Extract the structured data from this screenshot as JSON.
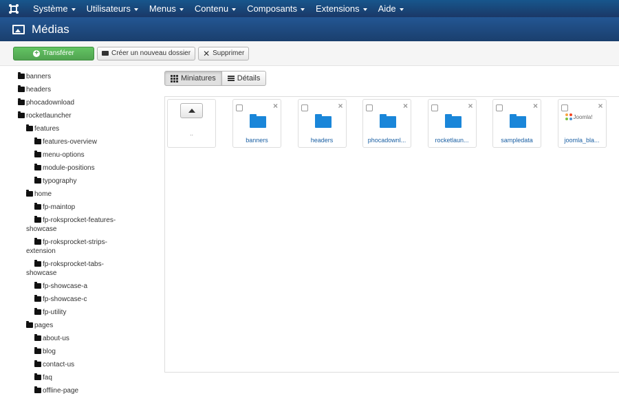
{
  "navbar": {
    "logo_icon": "joomla-logo-icon",
    "menu": [
      {
        "label": "Système"
      },
      {
        "label": "Utilisateurs"
      },
      {
        "label": "Menus"
      },
      {
        "label": "Contenu"
      },
      {
        "label": "Composants"
      },
      {
        "label": "Extensions"
      },
      {
        "label": "Aide"
      }
    ]
  },
  "page": {
    "title": "Médias",
    "title_icon": "image-icon"
  },
  "toolbar": {
    "upload_label": "Transférer",
    "new_folder_label": "Créer un nouveau dossier",
    "delete_label": "Supprimer"
  },
  "tree": [
    {
      "label": "banners",
      "level": 0
    },
    {
      "label": "headers",
      "level": 0
    },
    {
      "label": "phocadownload",
      "level": 0
    },
    {
      "label": "rocketlauncher",
      "level": 0
    },
    {
      "label": "features",
      "level": 1
    },
    {
      "label": "features-overview",
      "level": 2
    },
    {
      "label": "menu-options",
      "level": 2
    },
    {
      "label": "module-positions",
      "level": 2
    },
    {
      "label": "typography",
      "level": 2
    },
    {
      "label": "home",
      "level": 1
    },
    {
      "label": "fp-maintop",
      "level": 2
    },
    {
      "label": "fp-roksprocket-features-",
      "label2": "showcase",
      "level": 2
    },
    {
      "label": "fp-roksprocket-strips-",
      "label2": "extension",
      "level": 2
    },
    {
      "label": "fp-roksprocket-tabs-",
      "label2": "showcase",
      "level": 2
    },
    {
      "label": "fp-showcase-a",
      "level": 2
    },
    {
      "label": "fp-showcase-c",
      "level": 2
    },
    {
      "label": "fp-utility",
      "level": 2
    },
    {
      "label": "pages",
      "level": 1
    },
    {
      "label": "about-us",
      "level": 2
    },
    {
      "label": "blog",
      "level": 2
    },
    {
      "label": "contact-us",
      "level": 2
    },
    {
      "label": "faq",
      "level": 2
    },
    {
      "label": "offline-page",
      "level": 2
    }
  ],
  "view": {
    "thumbnails_label": "Miniatures",
    "details_label": "Détails"
  },
  "media": {
    "up_label": "..",
    "items": [
      {
        "label": "banners",
        "type": "folder"
      },
      {
        "label": "headers",
        "type": "folder"
      },
      {
        "label": "phocadownl...",
        "type": "folder"
      },
      {
        "label": "rocketlaun...",
        "type": "folder"
      },
      {
        "label": "sampledata",
        "type": "folder"
      },
      {
        "label": "joomla_bla...",
        "type": "image",
        "logo_text": "Joomla!"
      }
    ],
    "close_glyph": "×"
  },
  "colors": {
    "navbar": "#1a3867",
    "titlebar": "#1f4e82",
    "success": "#51a351",
    "folder": "#1a86d9",
    "link": "#1a5fa3"
  }
}
